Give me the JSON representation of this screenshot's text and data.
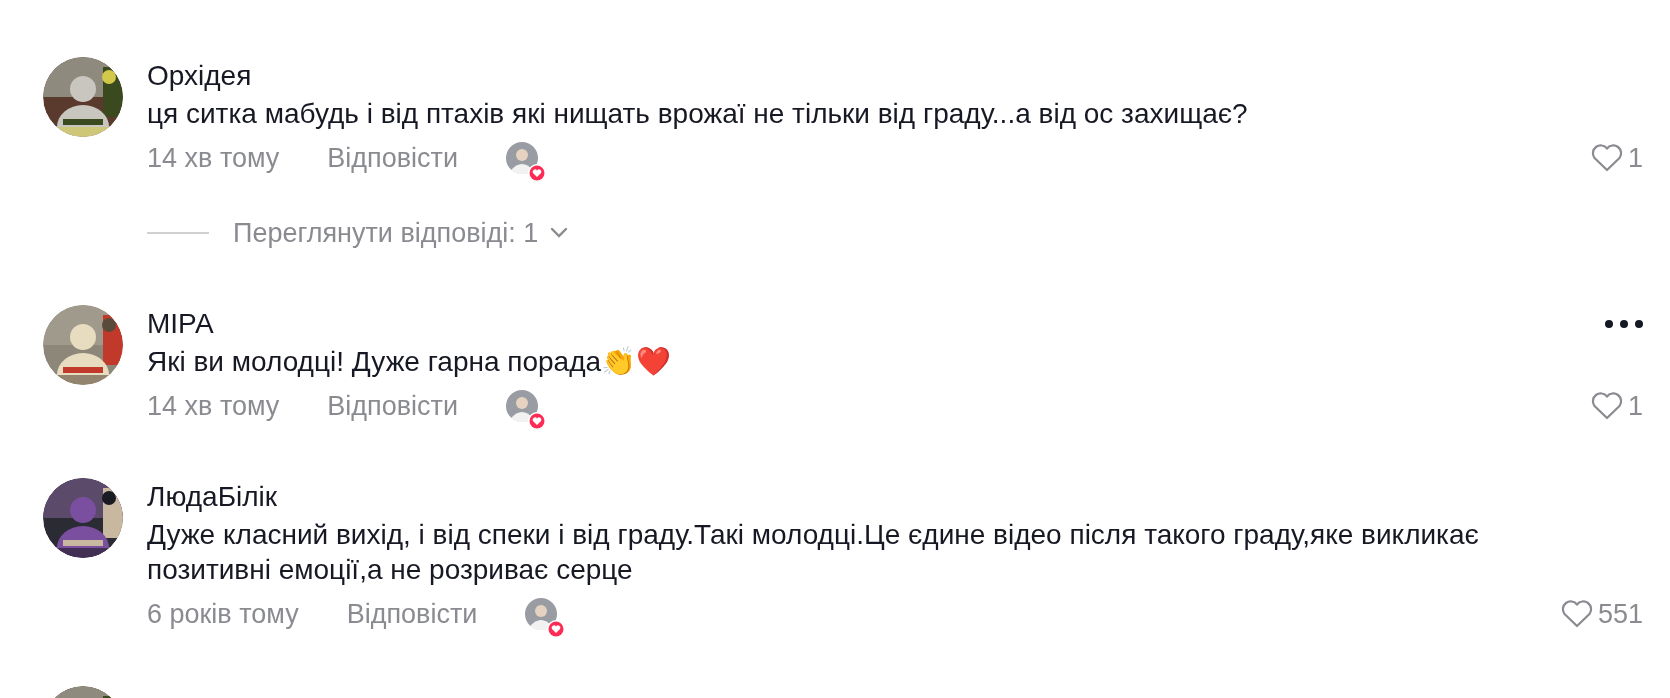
{
  "comments": [
    {
      "author": "Орхідея",
      "text": "ця ситка мабудь і від птахів які нищать врожаї не тільки від граду...а від ос захищає?",
      "time": "14 хв тому",
      "reply": "Відповісти",
      "liked_by_creator": true,
      "liked": false,
      "likes": "1",
      "show_menu": false,
      "replies_label": "Переглянути відповіді: 1"
    },
    {
      "author": "МІРА",
      "text": "Які ви молодці! Дуже гарна порада👏❤️",
      "time": "14 хв тому",
      "reply": "Відповісти",
      "liked_by_creator": true,
      "liked": false,
      "likes": "1",
      "show_menu": true
    },
    {
      "author": "ЛюдаБілік",
      "text": "Дуже класний вихід, і від спеки і від граду.Такі молодці.Це єдине відео після такого граду,яке викликає позитивні емоції,а не розриває серце",
      "time": "6 років тому",
      "reply": "Відповісти",
      "liked_by_creator": true,
      "liked": false,
      "likes": "551",
      "show_menu": false
    }
  ]
}
